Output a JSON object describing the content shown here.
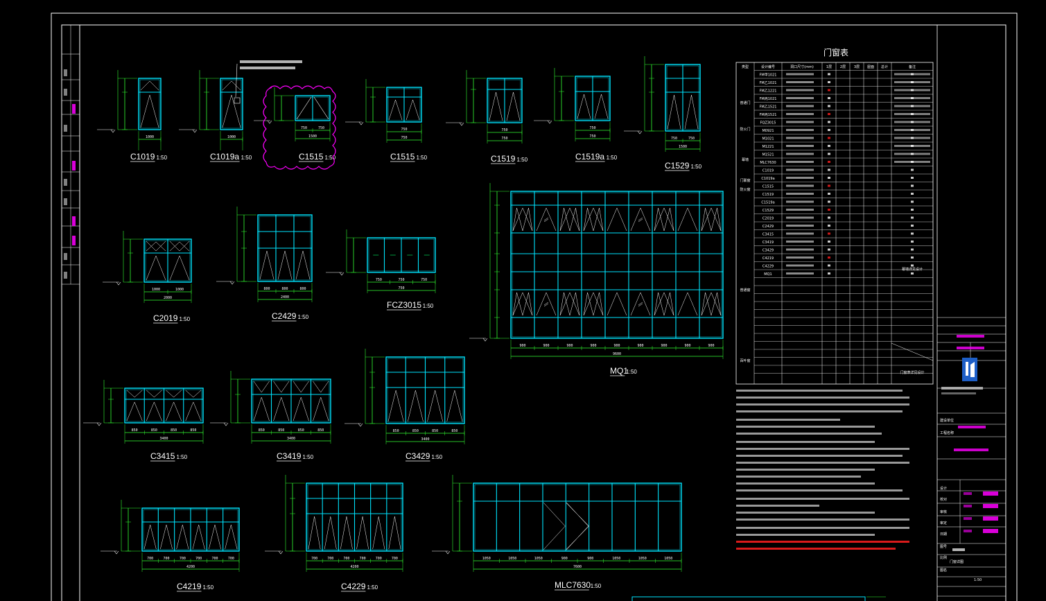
{
  "sheet": {
    "table_title": "门窗表",
    "table_headers": [
      "类型",
      "设计编号",
      "洞口尺寸(mm)",
      "1层",
      "2层",
      "3层",
      "屋面",
      "总计",
      "备注"
    ],
    "table_categories": [
      "普通门",
      "防火门",
      "普通窗",
      "幕墙",
      "门联窗",
      "防火窗",
      "百叶窗"
    ],
    "table_codes": [
      "FM甲1021",
      "FM乙1021",
      "FM乙1221",
      "FM丙1021",
      "FM乙1521",
      "FM丙1521",
      "FQZ3015",
      "M0921",
      "M1021",
      "M1221",
      "M1521",
      "MLC7630",
      "C1019",
      "C1019a",
      "C1515",
      "C1519",
      "C1519a",
      "C1529",
      "C2019",
      "C2429",
      "C3415",
      "C3419",
      "C3429",
      "C4219",
      "C4229",
      "MQ1"
    ],
    "table_note": "幕墙详见设计",
    "bottom_remark": "门窗表详见设计"
  },
  "windows": [
    {
      "code": "C1019",
      "scale": "1:50",
      "dims": [
        "1000"
      ]
    },
    {
      "code": "C1019a",
      "scale": "1:50",
      "dims": [
        "1000"
      ]
    },
    {
      "code": "C1515",
      "scale": "1:50",
      "dims": [
        "750",
        "750",
        "1500"
      ]
    },
    {
      "code": "C1515",
      "scale": "1:50",
      "dims": [
        "750",
        "750"
      ]
    },
    {
      "code": "C1519",
      "scale": "1:50",
      "dims": [
        "750",
        "750"
      ]
    },
    {
      "code": "C1519a",
      "scale": "1:50",
      "dims": [
        "750",
        "750"
      ]
    },
    {
      "code": "C1529",
      "scale": "1:50",
      "dims": [
        "750",
        "750",
        "1500"
      ]
    },
    {
      "code": "C2019",
      "scale": "1:50",
      "dims": [
        "1000",
        "1000",
        "2000"
      ]
    },
    {
      "code": "C2429",
      "scale": "1:50",
      "dims": [
        "800",
        "800",
        "800",
        "2400"
      ]
    },
    {
      "code": "FCZ3015",
      "scale": "1:50",
      "dims": [
        "750",
        "750",
        "750",
        "750"
      ]
    },
    {
      "code": "MQ1",
      "scale": "1:50",
      "dims": [
        "900",
        "900",
        "900",
        "900",
        "900",
        "900",
        "900",
        "900",
        "900",
        "9600"
      ]
    },
    {
      "code": "C3415",
      "scale": "1:50",
      "dims": [
        "850",
        "850",
        "850",
        "850",
        "3400"
      ]
    },
    {
      "code": "C3419",
      "scale": "1:50",
      "dims": [
        "850",
        "850",
        "850",
        "850",
        "3400"
      ]
    },
    {
      "code": "C3429",
      "scale": "1:50",
      "dims": [
        "850",
        "850",
        "850",
        "850",
        "3400"
      ]
    },
    {
      "code": "C4219",
      "scale": "1:50",
      "dims": [
        "700",
        "700",
        "700",
        "700",
        "700",
        "700",
        "4200"
      ]
    },
    {
      "code": "C4229",
      "scale": "1:50",
      "dims": [
        "700",
        "700",
        "700",
        "700",
        "700",
        "700",
        "4200"
      ]
    },
    {
      "code": "MLC7630",
      "scale": "1:50",
      "dims": [
        "1050",
        "1050",
        "1050",
        "900",
        "900",
        "1050",
        "1050",
        "1050",
        "7600"
      ]
    }
  ],
  "title_block": {
    "cells": [
      "建设单位",
      "工程名称",
      "设计",
      "校对",
      "审核",
      "审定",
      "日期",
      "图号",
      "比例",
      "图名"
    ],
    "scale_value": "1:50",
    "drawing_name": "门窗详图"
  },
  "colors": {
    "frame": "#00e5ff",
    "dim": "#33ff33",
    "text": "#ffffff",
    "cloud": "#ff00ff",
    "red": "#ff2020",
    "border": "#ffffff"
  }
}
